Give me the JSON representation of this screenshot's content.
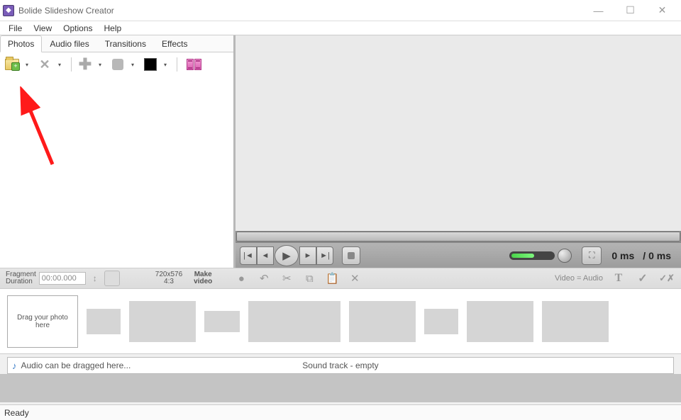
{
  "window": {
    "title": "Bolide Slideshow Creator"
  },
  "menu": {
    "items": [
      "File",
      "View",
      "Options",
      "Help"
    ]
  },
  "tabs": {
    "items": [
      "Photos",
      "Audio files",
      "Transitions",
      "Effects"
    ],
    "active": 0
  },
  "playbar": {
    "time_current": "0 ms",
    "time_total": "/ 0 ms"
  },
  "timeline_toolbar": {
    "fragment_label_l1": "Fragment",
    "fragment_label_l2": "Duration",
    "duration_value": "00:00.000",
    "resolution_l1": "720x576",
    "resolution_l2": "4:3",
    "make_l1": "Make",
    "make_l2": "video",
    "video_audio": "Video = Audio"
  },
  "storyboard": {
    "drop_hint": "Drag your photo here"
  },
  "audio_track": {
    "hint": "Audio can be dragged here...",
    "empty_label": "Sound track - empty"
  },
  "status": {
    "text": "Ready"
  }
}
